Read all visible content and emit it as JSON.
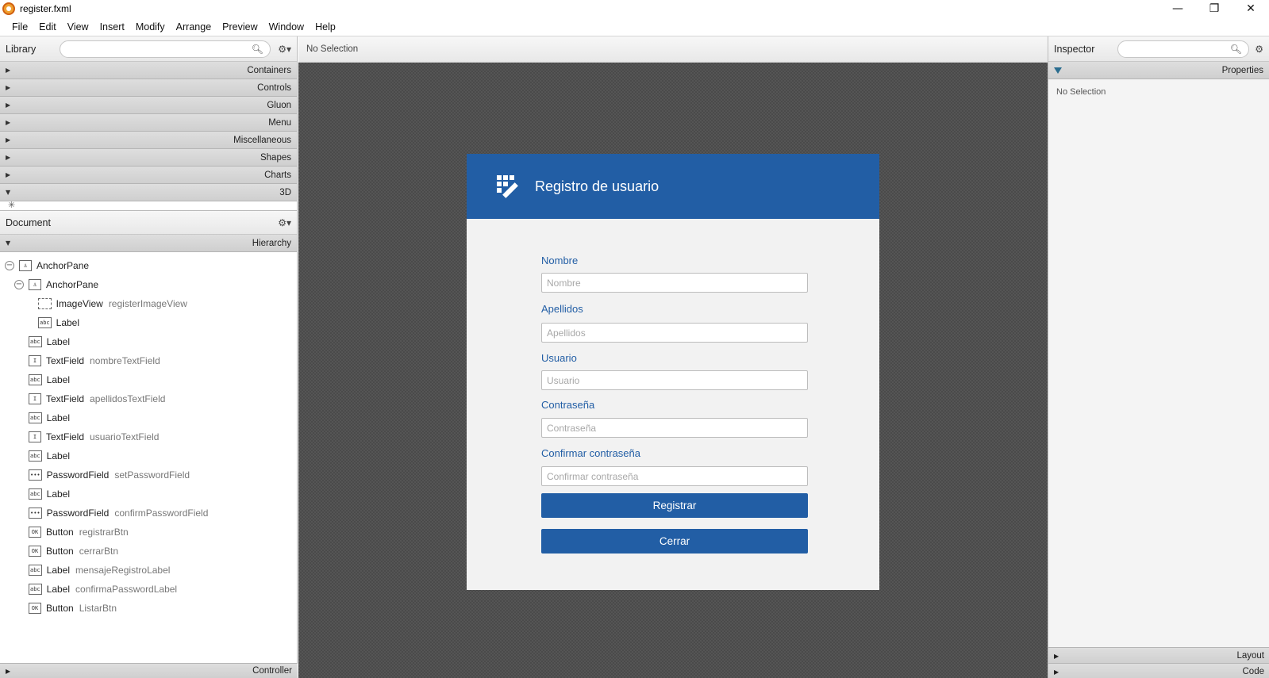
{
  "window": {
    "title": "register.fxml",
    "controls": [
      "—",
      "❐",
      "✕"
    ]
  },
  "menubar": [
    "File",
    "Edit",
    "View",
    "Insert",
    "Modify",
    "Arrange",
    "Preview",
    "Window",
    "Help"
  ],
  "library": {
    "title": "Library",
    "sections": [
      {
        "label": "Containers",
        "expanded": false
      },
      {
        "label": "Controls",
        "expanded": false
      },
      {
        "label": "Gluon",
        "expanded": false
      },
      {
        "label": "Menu",
        "expanded": false
      },
      {
        "label": "Miscellaneous",
        "expanded": false
      },
      {
        "label": "Shapes",
        "expanded": false
      },
      {
        "label": "Charts",
        "expanded": false
      },
      {
        "label": "3D",
        "expanded": true
      }
    ]
  },
  "document": {
    "title": "Document",
    "hierarchy_label": "Hierarchy",
    "controller_label": "Controller",
    "tree": [
      {
        "type": "AnchorPane",
        "id": "",
        "icon": "⚓",
        "level": 0,
        "collapsible": true
      },
      {
        "type": "AnchorPane",
        "id": "",
        "icon": "⚓",
        "level": 1,
        "collapsible": true
      },
      {
        "type": "ImageView",
        "id": "registerImageView",
        "icon": "img",
        "level": 2,
        "collapsible": false
      },
      {
        "type": "Label",
        "id": "",
        "icon": "abc",
        "level": 2,
        "collapsible": false
      },
      {
        "type": "Label",
        "id": "",
        "icon": "abc",
        "level": 1,
        "collapsible": false
      },
      {
        "type": "TextField",
        "id": "nombreTextField",
        "icon": "I",
        "level": 1,
        "collapsible": false
      },
      {
        "type": "Label",
        "id": "",
        "icon": "abc",
        "level": 1,
        "collapsible": false
      },
      {
        "type": "TextField",
        "id": "apellidosTextField",
        "icon": "I",
        "level": 1,
        "collapsible": false
      },
      {
        "type": "Label",
        "id": "",
        "icon": "abc",
        "level": 1,
        "collapsible": false
      },
      {
        "type": "TextField",
        "id": "usuarioTextField",
        "icon": "I",
        "level": 1,
        "collapsible": false
      },
      {
        "type": "Label",
        "id": "",
        "icon": "abc",
        "level": 1,
        "collapsible": false
      },
      {
        "type": "PasswordField",
        "id": "setPasswordField",
        "icon": "•••",
        "level": 1,
        "collapsible": false
      },
      {
        "type": "Label",
        "id": "",
        "icon": "abc",
        "level": 1,
        "collapsible": false
      },
      {
        "type": "PasswordField",
        "id": "confirmPasswordField",
        "icon": "•••",
        "level": 1,
        "collapsible": false
      },
      {
        "type": "Button",
        "id": "registrarBtn",
        "icon": "OK",
        "level": 1,
        "collapsible": false
      },
      {
        "type": "Button",
        "id": "cerrarBtn",
        "icon": "OK",
        "level": 1,
        "collapsible": false
      },
      {
        "type": "Label",
        "id": "mensajeRegistroLabel",
        "icon": "abc",
        "level": 1,
        "collapsible": false
      },
      {
        "type": "Label",
        "id": "confirmaPasswordLabel",
        "icon": "abc",
        "level": 1,
        "collapsible": false
      },
      {
        "type": "Button",
        "id": "ListarBtn",
        "icon": "OK",
        "level": 1,
        "collapsible": false
      }
    ]
  },
  "center": {
    "selection_text": "No Selection"
  },
  "form": {
    "title": "Registro de usuario",
    "fields": [
      {
        "label": "Nombre",
        "placeholder": "Nombre"
      },
      {
        "label": "Apellidos",
        "placeholder": "Apellidos"
      },
      {
        "label": "Usuario",
        "placeholder": "Usuario"
      },
      {
        "label": "Contraseña",
        "placeholder": "Contraseña"
      },
      {
        "label": "Confirmar contraseña",
        "placeholder": "Confirmar contraseña"
      }
    ],
    "register_button": "Registrar",
    "close_button": "Cerrar",
    "header_color": "#225ea5"
  },
  "inspector": {
    "title": "Inspector",
    "properties_label": "Properties",
    "no_selection": "No Selection",
    "layout_label": "Layout",
    "code_label": "Code"
  }
}
